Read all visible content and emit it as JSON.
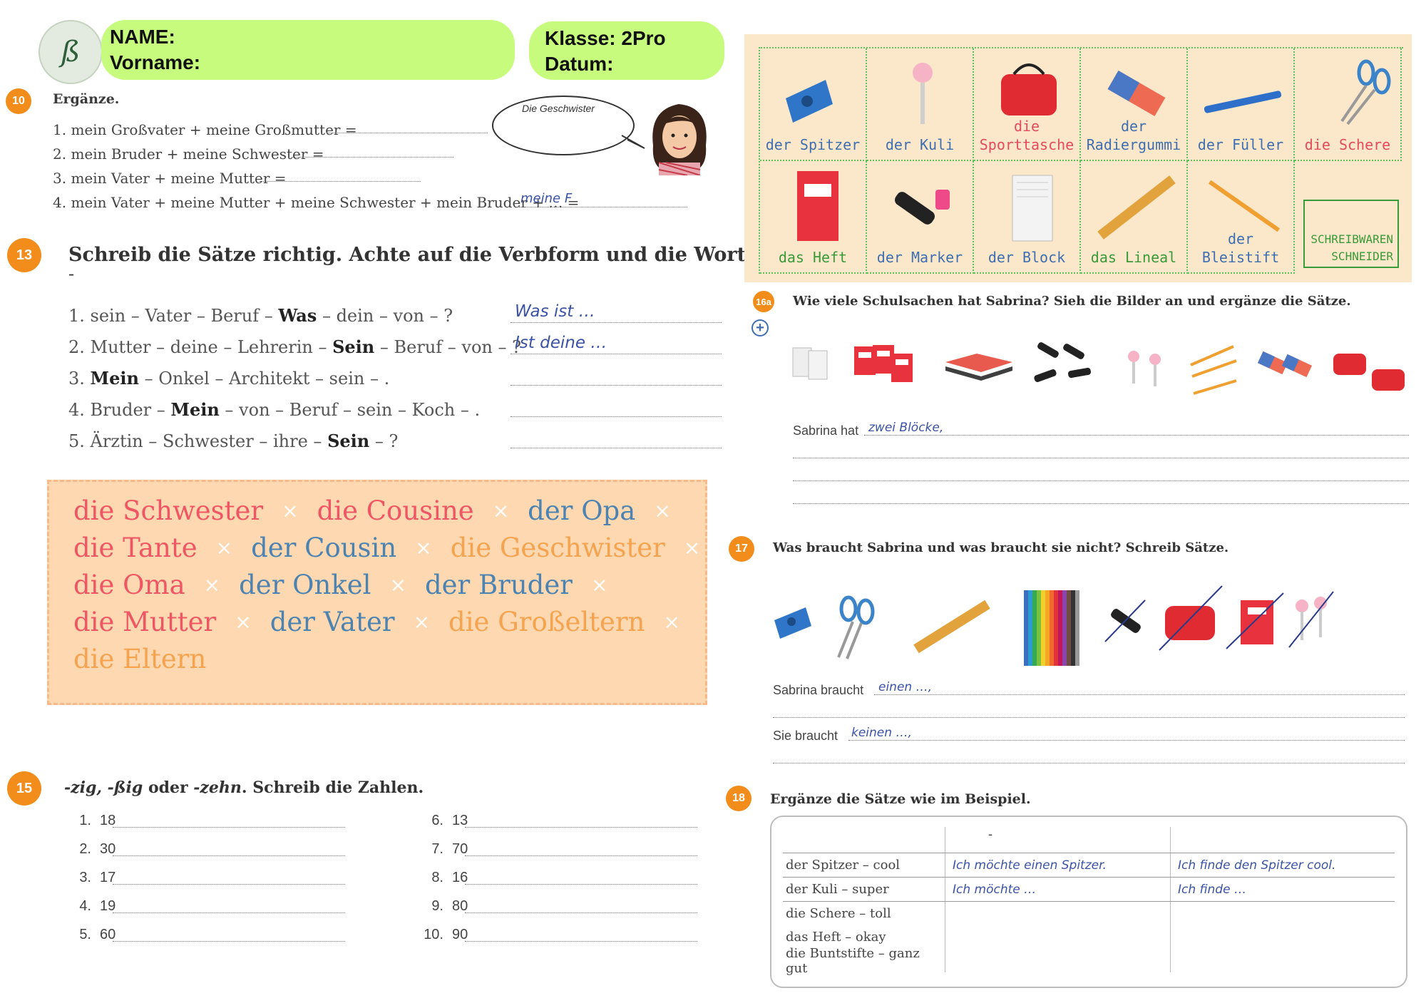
{
  "header": {
    "name_label": "NAME:",
    "vorname_label": "Vorname:",
    "klasse_label": "Klasse: 2Pro",
    "datum_label": "Datum:",
    "logo_glyph": "ß"
  },
  "ex10": {
    "number": "10",
    "title": "Ergänze.",
    "bubble": "Die Geschwister",
    "items": [
      "1. mein Großvater + meine Großmutter =",
      "2. mein Bruder + meine Schwester =",
      "3. mein Vater + meine Mutter =",
      "4. mein Vater + meine Mutter + meine Schwester + mein Bruder + … ="
    ],
    "answer4": "meine F"
  },
  "ex13": {
    "number": "13",
    "title": "Schreib die Sätze richtig. Achte auf die Verbform und die Wortfolge.",
    "dash": "-",
    "items": [
      {
        "pre": "1. sein – Vater – Beruf – ",
        "bold": "Was",
        "post": "  – dein – von – ?",
        "answer": "Was ist …"
      },
      {
        "pre": "2. Mutter – deine – Lehrerin – ",
        "bold": "Sein",
        "post": " – Beruf – von – ?",
        "answer": "Ist deine …"
      },
      {
        "pre": "3. ",
        "bold": "Mein",
        "post": " – Onkel – Architekt – sein – .",
        "answer": ""
      },
      {
        "pre": "4. Bruder – ",
        "bold": "Mein",
        "post": " – von – Beruf – sein – Koch – .",
        "answer": ""
      },
      {
        "pre": "5. Ärztin – Schwester – ihre – ",
        "bold": "Sein",
        "post": " – ?",
        "answer": ""
      }
    ]
  },
  "family_words": {
    "separator": "×",
    "rows": [
      [
        {
          "t": "die Schwester",
          "c": "pink"
        },
        {
          "t": "die Cousine",
          "c": "pink"
        },
        {
          "t": "der Opa",
          "c": "blue"
        }
      ],
      [
        {
          "t": "die Tante",
          "c": "pink"
        },
        {
          "t": "der Cousin",
          "c": "blue"
        },
        {
          "t": "die Geschwister",
          "c": "orange"
        }
      ],
      [
        {
          "t": "die Oma",
          "c": "pink"
        },
        {
          "t": "der Onkel",
          "c": "blue"
        },
        {
          "t": "der Bruder",
          "c": "blue"
        }
      ],
      [
        {
          "t": "die Mutter",
          "c": "pink"
        },
        {
          "t": "der Vater",
          "c": "blue"
        },
        {
          "t": "die Großeltern",
          "c": "orange"
        }
      ],
      [
        {
          "t": "die Eltern",
          "c": "orange"
        }
      ]
    ]
  },
  "ex15": {
    "number": "15",
    "title_parts": [
      "-zig, -ßig",
      " oder ",
      "-zehn",
      ". Schreib die Zahlen."
    ],
    "left": [
      [
        "1.",
        "18"
      ],
      [
        "2.",
        "30"
      ],
      [
        "3.",
        "17"
      ],
      [
        "4.",
        "19"
      ],
      [
        "5.",
        "60"
      ]
    ],
    "right": [
      [
        "6.",
        "13"
      ],
      [
        "7.",
        "70"
      ],
      [
        "8.",
        "16"
      ],
      [
        "9.",
        "80"
      ],
      [
        "10.",
        "90"
      ]
    ]
  },
  "supplies": {
    "row1": [
      {
        "label": "der Spitzer",
        "color": "blue",
        "icon": "sharpener-icon"
      },
      {
        "label": "der Kuli",
        "color": "blue",
        "icon": "pen-icon"
      },
      {
        "label": "die\nSporttasche",
        "color": "red",
        "icon": "bag-icon"
      },
      {
        "label": "der\nRadiergummi",
        "color": "blue",
        "icon": "eraser-icon"
      },
      {
        "label": "der Füller",
        "color": "blue",
        "icon": "fountain-pen-icon"
      },
      {
        "label": "die Schere",
        "color": "red",
        "icon": "scissors-icon"
      }
    ],
    "row2": [
      {
        "label": "das Heft",
        "color": "green",
        "icon": "notebook-icon"
      },
      {
        "label": "der Marker",
        "color": "blue",
        "icon": "marker-icon"
      },
      {
        "label": "der Block",
        "color": "blue",
        "icon": "notepad-icon"
      },
      {
        "label": "das Lineal",
        "color": "green",
        "icon": "ruler-icon"
      },
      {
        "label": "der Bleistift",
        "color": "blue",
        "icon": "pencil-icon"
      }
    ],
    "shop_line1": "SCHREIBWAREN",
    "shop_line2": "SCHNEIDER"
  },
  "ex16a": {
    "number": "16a",
    "plus": "+",
    "title": "Wie viele Schulsachen hat Sabrina? Sieh die Bilder an und ergänze die Sätze.",
    "sentence_start": "Sabrina hat",
    "answer": "zwei Blöcke,"
  },
  "ex17": {
    "number": "17",
    "title": "Was braucht Sabrina und was braucht sie nicht? Schreib Sätze.",
    "line1_label": "Sabrina braucht",
    "line1_answer": "einen …,",
    "line2_label": "Sie braucht",
    "line2_answer": "keinen …,"
  },
  "ex18": {
    "number": "18",
    "title": "Ergänze die Sätze wie im Beispiel.",
    "header_mark": "-",
    "rows": [
      [
        "der Spitzer – cool",
        "Ich möchte einen Spitzer.",
        "Ich finde den Spitzer cool."
      ],
      [
        "der Kuli – super",
        "Ich möchte …",
        "Ich finde …"
      ],
      [
        "die Schere – toll",
        "",
        ""
      ],
      [
        "das Heft – okay",
        "",
        ""
      ],
      [
        "die Buntstifte – ganz gut",
        "",
        ""
      ]
    ]
  },
  "colors": {
    "accent_orange": "#f28c1b",
    "pill_green": "#c6fb7e",
    "handwriting_blue": "#3b53a6",
    "supplies_bg": "#fbe7c9",
    "family_bg": "#fdd8b0"
  }
}
